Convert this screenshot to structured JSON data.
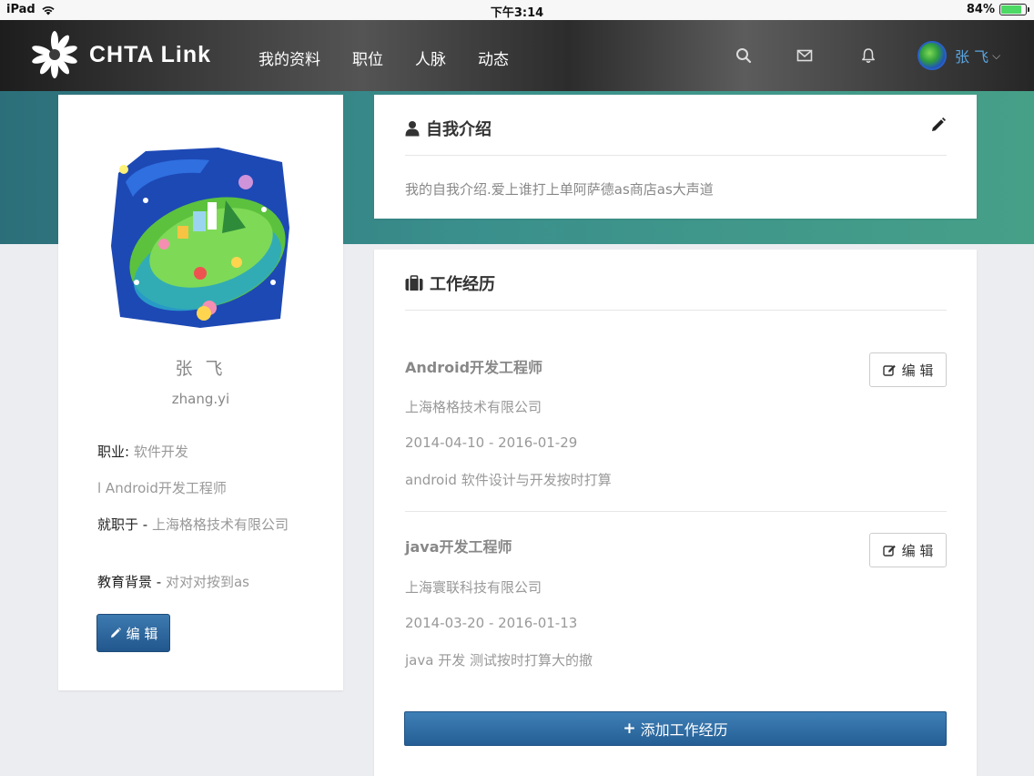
{
  "status_bar": {
    "device": "iPad",
    "time": "下午3:14",
    "battery": "84%",
    "battery_level": 0.84
  },
  "nav": {
    "brand": "CHTA Link",
    "links": [
      "我的资料",
      "职位",
      "人脉",
      "动态"
    ],
    "icons": [
      "search-icon",
      "mail-icon",
      "bell-icon"
    ],
    "user_name": "张 飞"
  },
  "profile": {
    "name": "张 飞",
    "username": "zhang.yi",
    "occupation_label": "职业: ",
    "occupation_value": "软件开发",
    "title_line": "l Android开发工程师",
    "employer_label": "就职于 - ",
    "employer_value": "上海格格技术有限公司",
    "education_label": "教育背景 - ",
    "education_value": "对对对按到as",
    "edit_label": "编 辑"
  },
  "intro": {
    "title": "自我介绍",
    "text": "我的自我介绍.爱上谁打上单阿萨德as商店as大声道"
  },
  "work": {
    "title": "工作经历",
    "jobs": [
      {
        "title": "Android开发工程师",
        "company": "上海格格技术有限公司",
        "dates": "2014-04-10 - 2016-01-29",
        "description": "android 软件设计与开发按时打算",
        "edit_label": "编 辑"
      },
      {
        "title": "java开发工程师",
        "company": "上海寰联科技有限公司",
        "dates": "2014-03-20 - 2016-01-13",
        "description": "java 开发 测试按时打算大的撤",
        "edit_label": "编 辑"
      }
    ],
    "add_label": "添加工作经历"
  },
  "colors": {
    "accent": "#2b6aa3",
    "teal": "#3a8f8c",
    "user_name": "#5aa5e0"
  }
}
